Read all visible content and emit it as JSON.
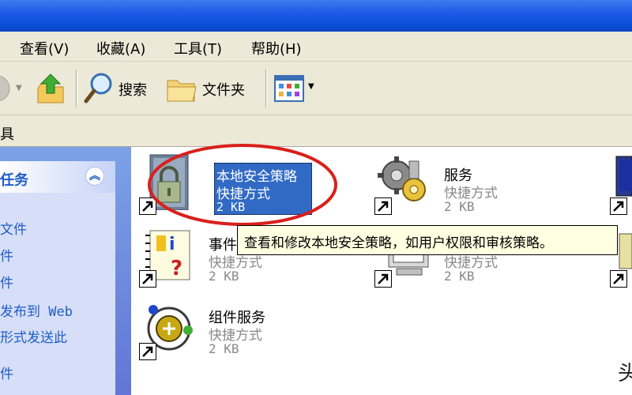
{
  "menu": {
    "view": "查看(V)",
    "favorites": "收藏(A)",
    "tools": "工具(T)",
    "help": "帮助(H)"
  },
  "toolbar": {
    "search": "搜索",
    "folders": "文件夹"
  },
  "address": {
    "label": "具"
  },
  "tasks": {
    "title": "任务",
    "items": [
      "文件",
      "件",
      "件",
      "发布到 Web",
      "形式发送此",
      "件"
    ]
  },
  "items": [
    {
      "name": "本地安全策略",
      "type": "快捷方式",
      "size": "2 KB",
      "selected": true,
      "icon": "local-security-policy-icon"
    },
    {
      "name": "服务",
      "type": "快捷方式",
      "size": "2 KB",
      "icon": "services-gears-icon"
    },
    {
      "name": "事件",
      "type": "快捷方式",
      "size": "2 KB",
      "icon": "event-viewer-icon"
    },
    {
      "name": "",
      "type": "快捷方式",
      "size": "2 KB",
      "icon": "computer-management-icon"
    },
    {
      "name": "组件服务",
      "type": "快捷方式",
      "size": "2 KB",
      "icon": "component-services-icon"
    }
  ],
  "tooltip": "查看和修改本地安全策略，如用户权限和审核策略。",
  "watermark": "头",
  "colors": {
    "selection": "#316ac5",
    "tooltip_bg": "#ffffe1",
    "annotation_circle": "#d9201c",
    "link": "#215dc6"
  }
}
